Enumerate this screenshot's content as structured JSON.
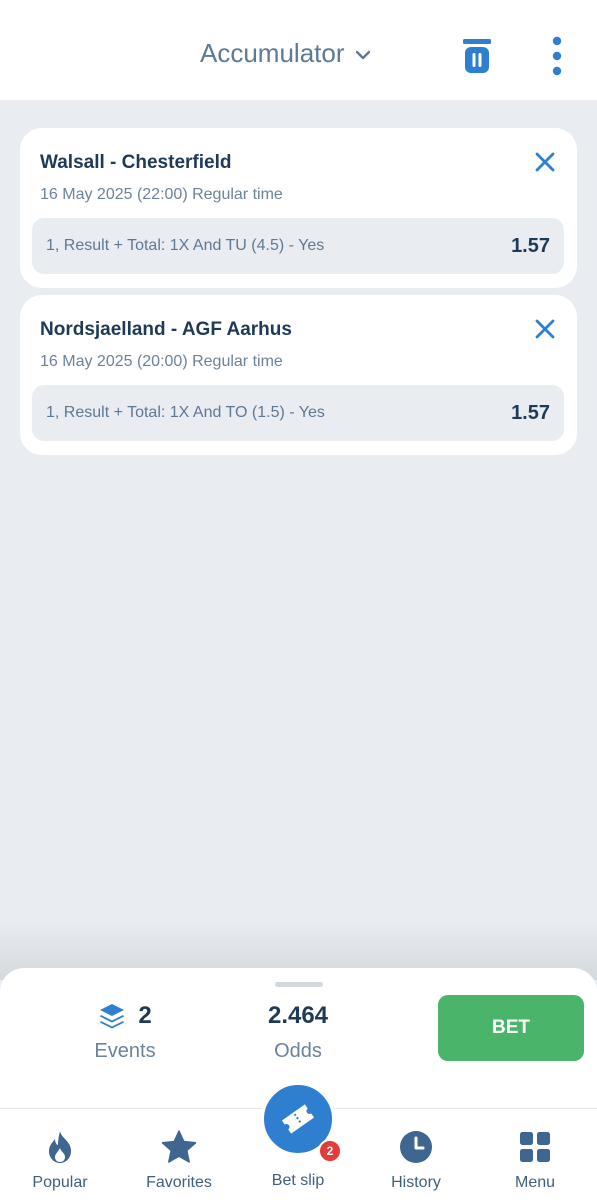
{
  "header": {
    "title": "Accumulator",
    "icons": {
      "dropdown": "chevron-down-icon",
      "trash": "trash-icon",
      "more": "more-vertical-icon"
    }
  },
  "bets": [
    {
      "match": "Walsall - Chesterfield",
      "date": "16 May 2025 (22:00) Regular time",
      "market": "1, Result + Total: 1X And TU (4.5) - Yes",
      "odd": "1.57"
    },
    {
      "match": "Nordsjaelland - AGF Aarhus",
      "date": "16 May 2025 (20:00) Regular time",
      "market": "1, Result + Total: 1X And TO (1.5) - Yes",
      "odd": "1.57"
    }
  ],
  "summary": {
    "events_value": "2",
    "events_label": "Events",
    "odds_value": "2.464",
    "odds_label": "Odds",
    "bet_label": "BET"
  },
  "nav": {
    "items": [
      {
        "label": "Popular",
        "icon": "flame-icon"
      },
      {
        "label": "Favorites",
        "icon": "star-icon"
      },
      {
        "label": "Bet slip",
        "icon": "ticket-icon",
        "badge": "2"
      },
      {
        "label": "History",
        "icon": "clock-icon"
      },
      {
        "label": "Menu",
        "icon": "grid-icon"
      }
    ]
  },
  "colors": {
    "accent": "#2e7fd0",
    "bet_button": "#4ab56a",
    "badge": "#e53b3b",
    "text_dark": "#1f3a57",
    "text_muted": "#6c8298",
    "background": "#e9edf1"
  }
}
